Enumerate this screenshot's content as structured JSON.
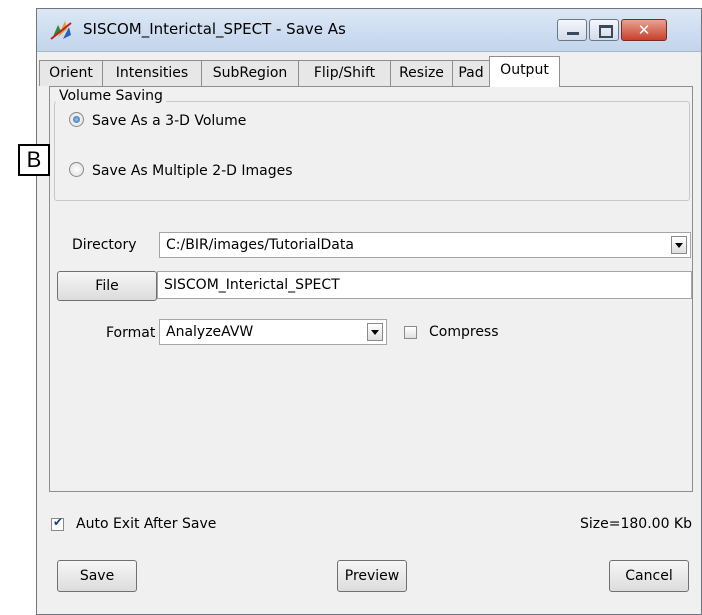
{
  "window": {
    "title": "SISCOM_Interictal_SPECT - Save As"
  },
  "tabs": [
    {
      "label": "Orient"
    },
    {
      "label": "Intensities"
    },
    {
      "label": "SubRegion"
    },
    {
      "label": "Flip/Shift"
    },
    {
      "label": "Resize"
    },
    {
      "label": "Pad"
    },
    {
      "label": "Output",
      "active": true
    }
  ],
  "volume_saving": {
    "legend": "Volume Saving",
    "option_3d": "Save As a 3-D Volume",
    "option_2d": "Save As Multiple 2-D Images",
    "selected": "3d"
  },
  "directory": {
    "label": "Directory",
    "value": "C:/BIR/images/TutorialData"
  },
  "file": {
    "button_label": "File",
    "value": "SISCOM_Interictal_SPECT"
  },
  "format": {
    "label": "Format",
    "value": "AnalyzeAVW",
    "compress_label": "Compress",
    "compress_checked": false
  },
  "footer": {
    "auto_exit_label": "Auto Exit After Save",
    "auto_exit_checked": true,
    "size_text": "Size=180.00 Kb",
    "save_label": "Save",
    "preview_label": "Preview",
    "cancel_label": "Cancel"
  },
  "callout_label": "B",
  "colors": {
    "close_button": "#c7402c",
    "titlebar": "#c3d5ec",
    "radio_checked": "#1c5fa8"
  }
}
